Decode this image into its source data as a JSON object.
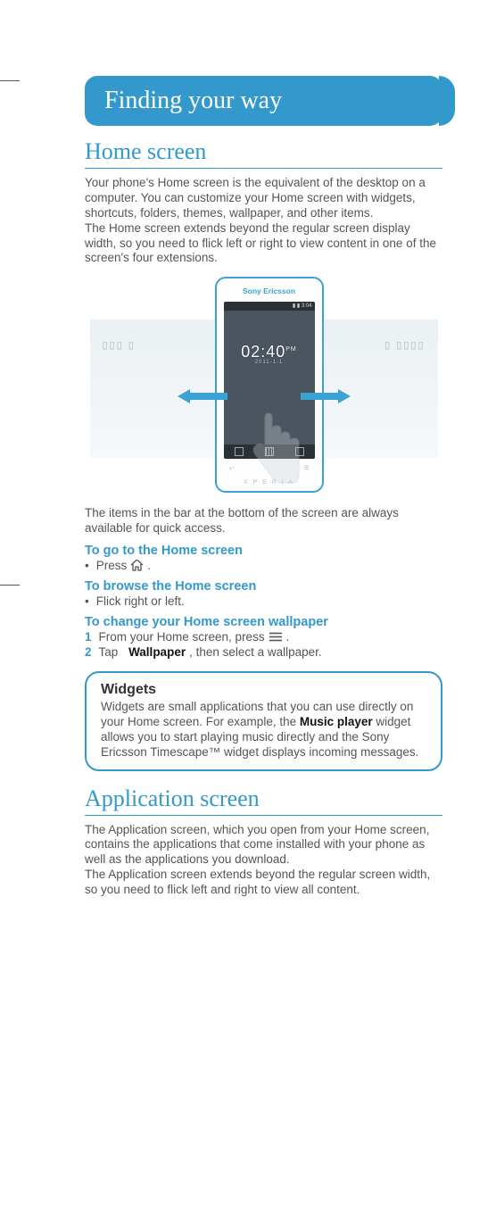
{
  "header": {
    "title": "Finding your way"
  },
  "section1": {
    "title": "Home screen",
    "para": "Your phone's Home screen is the equivalent of the desktop on a computer. You can customize your Home screen with widgets, shortcuts, folders, themes, wallpaper, and other items.\nThe Home screen extends beyond the regular screen display width, so you need to flick left or right to view content in one of the screen's four extensions."
  },
  "illustration": {
    "brand": "Sony Ericsson",
    "xperia": "X P E R I A",
    "status_time": "3:04",
    "clock": "02:40",
    "clock_ampm": "PM",
    "clock_date": "2011-1-1"
  },
  "bottom_note": "The items in the bar at the bottom of the screen are always available for quick access.",
  "howto1": {
    "title": "To go to the Home screen",
    "step": "Press",
    "icon": "home-icon",
    "suffix": "."
  },
  "howto2": {
    "title": "To browse the Home screen",
    "step": "Flick right or left."
  },
  "howto3": {
    "title": "To change your Home screen wallpaper",
    "step1_prefix": "From your Home screen, press",
    "step1_suffix": ".",
    "step2_prefix": "Tap",
    "step2_strong": "Wallpaper",
    "step2_suffix": ", then select a wallpaper."
  },
  "callout": {
    "title": "Widgets",
    "body_prefix": "Widgets are small applications that you can use directly on your Home screen. For example, the ",
    "body_strong": "Music player",
    "body_suffix": " widget allows you to start playing music directly and the Sony Ericsson Timescape™ widget displays incoming messages."
  },
  "section2": {
    "title": "Application screen",
    "para": "The Application screen, which you open from your Home screen, contains the applications that come installed with your phone as well as the applications you download.\nThe Application screen extends beyond the regular screen width, so you need to flick left and right to view all content."
  }
}
